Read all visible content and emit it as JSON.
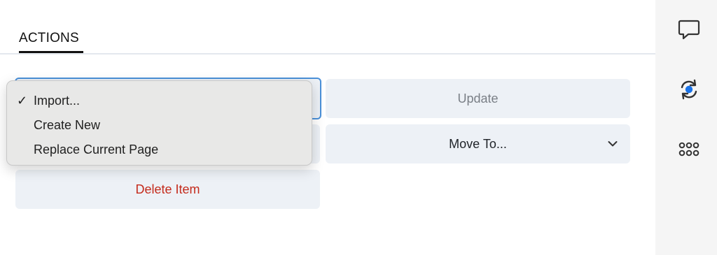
{
  "panel": {
    "tab_label": "ACTIONS"
  },
  "buttons": {
    "update_label": "Update",
    "move_to_label": "Move To...",
    "delete_label": "Delete Item"
  },
  "dropdown": {
    "options": [
      {
        "label": "Import...",
        "selected": true,
        "check": "✓"
      },
      {
        "label": "Create New",
        "selected": false
      },
      {
        "label": "Replace Current Page",
        "selected": false
      }
    ]
  },
  "rail": {
    "icons": [
      "comment-icon",
      "sync-icon",
      "apps-grid-icon"
    ]
  },
  "colors": {
    "button_bg": "#edf1f6",
    "focus_border": "#4a90d9",
    "danger_text": "#c42b1c",
    "sync_dot": "#1a73e8"
  }
}
